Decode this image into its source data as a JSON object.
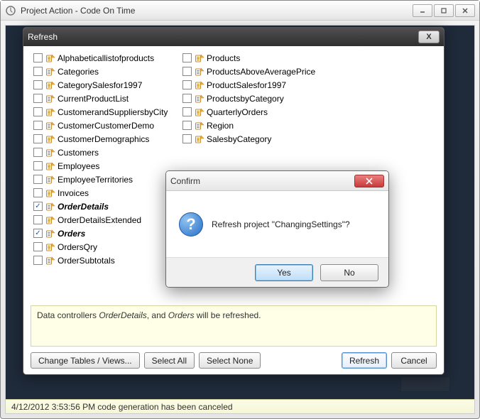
{
  "window": {
    "title": "Project Action - Code On Time"
  },
  "refresh": {
    "title": "Refresh",
    "columns": [
      [
        {
          "label": "Alphabeticallistofproducts",
          "checked": false,
          "bold": false
        },
        {
          "label": "Categories",
          "checked": false,
          "bold": false
        },
        {
          "label": "CategorySalesfor1997",
          "checked": false,
          "bold": false
        },
        {
          "label": "CurrentProductList",
          "checked": false,
          "bold": false
        },
        {
          "label": "CustomerandSuppliersbyCity",
          "checked": false,
          "bold": false
        },
        {
          "label": "CustomerCustomerDemo",
          "checked": false,
          "bold": false
        },
        {
          "label": "CustomerDemographics",
          "checked": false,
          "bold": false
        },
        {
          "label": "Customers",
          "checked": false,
          "bold": false
        },
        {
          "label": "Employees",
          "checked": false,
          "bold": false
        },
        {
          "label": "EmployeeTerritories",
          "checked": false,
          "bold": false
        },
        {
          "label": "Invoices",
          "checked": false,
          "bold": false
        },
        {
          "label": "OrderDetails",
          "checked": true,
          "bold": true
        },
        {
          "label": "OrderDetailsExtended",
          "checked": false,
          "bold": false
        },
        {
          "label": "Orders",
          "checked": true,
          "bold": true
        },
        {
          "label": "OrdersQry",
          "checked": false,
          "bold": false
        },
        {
          "label": "OrderSubtotals",
          "checked": false,
          "bold": false
        }
      ],
      [
        {
          "label": "Products",
          "checked": false,
          "bold": false
        },
        {
          "label": "ProductsAboveAveragePrice",
          "checked": false,
          "bold": false
        },
        {
          "label": "ProductSalesfor1997",
          "checked": false,
          "bold": false
        },
        {
          "label": "ProductsbyCategory",
          "checked": false,
          "bold": false
        },
        {
          "label": "QuarterlyOrders",
          "checked": false,
          "bold": false
        },
        {
          "label": "Region",
          "checked": false,
          "bold": false
        },
        {
          "label": "SalesbyCategory",
          "checked": false,
          "bold": false
        }
      ]
    ],
    "info_prefix": "Data controllers ",
    "info_bold1": "OrderDetails",
    "info_mid": ", and ",
    "info_bold2": "Orders",
    "info_suffix": " will be refreshed.",
    "buttons": {
      "change": "Change Tables / Views...",
      "select_all": "Select All",
      "select_none": "Select None",
      "refresh": "Refresh",
      "cancel": "Cancel"
    }
  },
  "confirm": {
    "title": "Confirm",
    "message": "Refresh project \"ChangingSettings\"?",
    "yes": "Yes",
    "no": "No"
  },
  "status": {
    "text": "4/12/2012 3:53:56 PM code generation has been canceled"
  }
}
